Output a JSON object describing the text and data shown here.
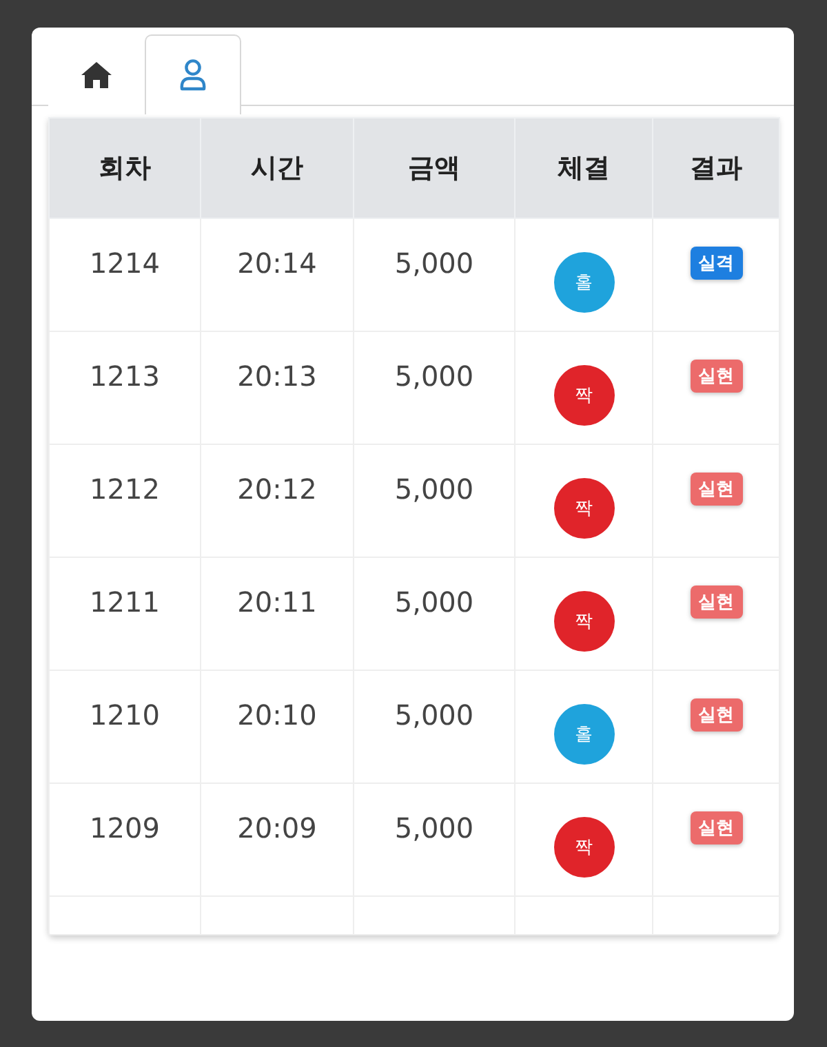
{
  "tabs": [
    {
      "kind": "home",
      "selected": false
    },
    {
      "kind": "user",
      "selected": true
    }
  ],
  "table": {
    "columns": [
      "회차",
      "시간",
      "금액",
      "체결",
      "결과"
    ],
    "rows": [
      {
        "round": "1214",
        "time": "20:14",
        "amount": "5,000",
        "ball": {
          "label": "홀",
          "color": "#1fa3dc"
        },
        "result": {
          "label": "실격",
          "color": "#1e7fe0"
        }
      },
      {
        "round": "1213",
        "time": "20:13",
        "amount": "5,000",
        "ball": {
          "label": "짝",
          "color": "#e0242a"
        },
        "result": {
          "label": "실현",
          "color": "#ec6b6b"
        }
      },
      {
        "round": "1212",
        "time": "20:12",
        "amount": "5,000",
        "ball": {
          "label": "짝",
          "color": "#e0242a"
        },
        "result": {
          "label": "실현",
          "color": "#ec6b6b"
        }
      },
      {
        "round": "1211",
        "time": "20:11",
        "amount": "5,000",
        "ball": {
          "label": "짝",
          "color": "#e0242a"
        },
        "result": {
          "label": "실현",
          "color": "#ec6b6b"
        }
      },
      {
        "round": "1210",
        "time": "20:10",
        "amount": "5,000",
        "ball": {
          "label": "홀",
          "color": "#1fa3dc"
        },
        "result": {
          "label": "실현",
          "color": "#ec6b6b"
        }
      },
      {
        "round": "1209",
        "time": "20:09",
        "amount": "5,000",
        "ball": {
          "label": "짝",
          "color": "#e0242a"
        },
        "result": {
          "label": "실현",
          "color": "#ec6b6b"
        }
      }
    ]
  }
}
